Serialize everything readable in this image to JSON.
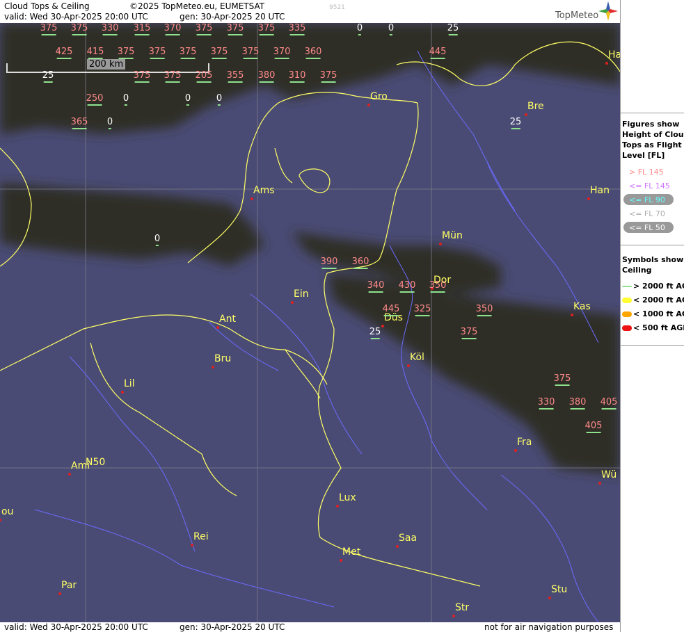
{
  "header": {
    "title": "Cloud Tops & Ceiling",
    "copyright": "©2025 TopMeteo.eu, EUMETSAT",
    "valid": "valid:  Wed  30-Apr-2025  20:00 UTC",
    "generated": "gen: 30-Apr-2025 20 UTC",
    "code": "9521",
    "brand": "TopMeteo"
  },
  "footer": {
    "valid": "valid:  Wed  30-Apr-2025  20:00 UTC",
    "generated": "gen: 30-Apr-2025 20 UTC",
    "disclaimer": "not for air navigation purposes"
  },
  "scale_bar": {
    "label": "200 km"
  },
  "legend": {
    "title_lines": [
      "Figures show",
      "Height of Cloud",
      "Tops as Flight",
      "Level  [FL]"
    ],
    "levels": [
      {
        "label": "> FL 145",
        "color": "#ff8a8a"
      },
      {
        "label": "<= FL 145",
        "color": "#d070ff"
      },
      {
        "label": "<= FL 90",
        "color": "#6ff"
      },
      {
        "label": "<= FL 70",
        "color": "#aaa"
      },
      {
        "label": "<= FL 50",
        "color": "#fff"
      }
    ],
    "symbols_title_lines": [
      "Symbols show",
      "Ceiling"
    ],
    "symbols": [
      {
        "label": "> 2000 ft AGL",
        "color": "#8fe38f"
      },
      {
        "label": "< 2000 ft AGL",
        "color": "#ffff33"
      },
      {
        "label": "< 1000 ft AGL",
        "color": "#ffa500"
      },
      {
        "label": "< 500 ft AGL",
        "color": "#ee1111"
      }
    ]
  },
  "lat_label": "N50",
  "cities": [
    {
      "name": "Gro"
    },
    {
      "name": "Bre"
    },
    {
      "name": "Ha"
    },
    {
      "name": "Ams"
    },
    {
      "name": "Han"
    },
    {
      "name": "Mün"
    },
    {
      "name": "Dor"
    },
    {
      "name": "Ein"
    },
    {
      "name": "Kas"
    },
    {
      "name": "Ant"
    },
    {
      "name": "Düs"
    },
    {
      "name": "Köl"
    },
    {
      "name": "Bru"
    },
    {
      "name": "Lil"
    },
    {
      "name": "Fra"
    },
    {
      "name": "Ami"
    },
    {
      "name": "Wü"
    },
    {
      "name": "Lux"
    },
    {
      "name": "ou"
    },
    {
      "name": "Rei"
    },
    {
      "name": "Saa"
    },
    {
      "name": "Met"
    },
    {
      "name": "Par"
    },
    {
      "name": "Stu"
    },
    {
      "name": "Str"
    }
  ],
  "cloud_tops": [
    "375",
    "375",
    "330",
    "315",
    "370",
    "375",
    "375",
    "375",
    "335",
    "0",
    "0",
    "25",
    "425",
    "415",
    "375",
    "375",
    "375",
    "375",
    "375",
    "370",
    "360",
    "445",
    "25",
    "375",
    "375",
    "205",
    "355",
    "380",
    "310",
    "375",
    "250",
    "0",
    "0",
    "0",
    "365",
    "0",
    "25",
    "0",
    "390",
    "360",
    "340",
    "430",
    "350",
    "445",
    "325",
    "350",
    "25",
    "375",
    "375",
    "330",
    "380",
    "405",
    "405"
  ]
}
